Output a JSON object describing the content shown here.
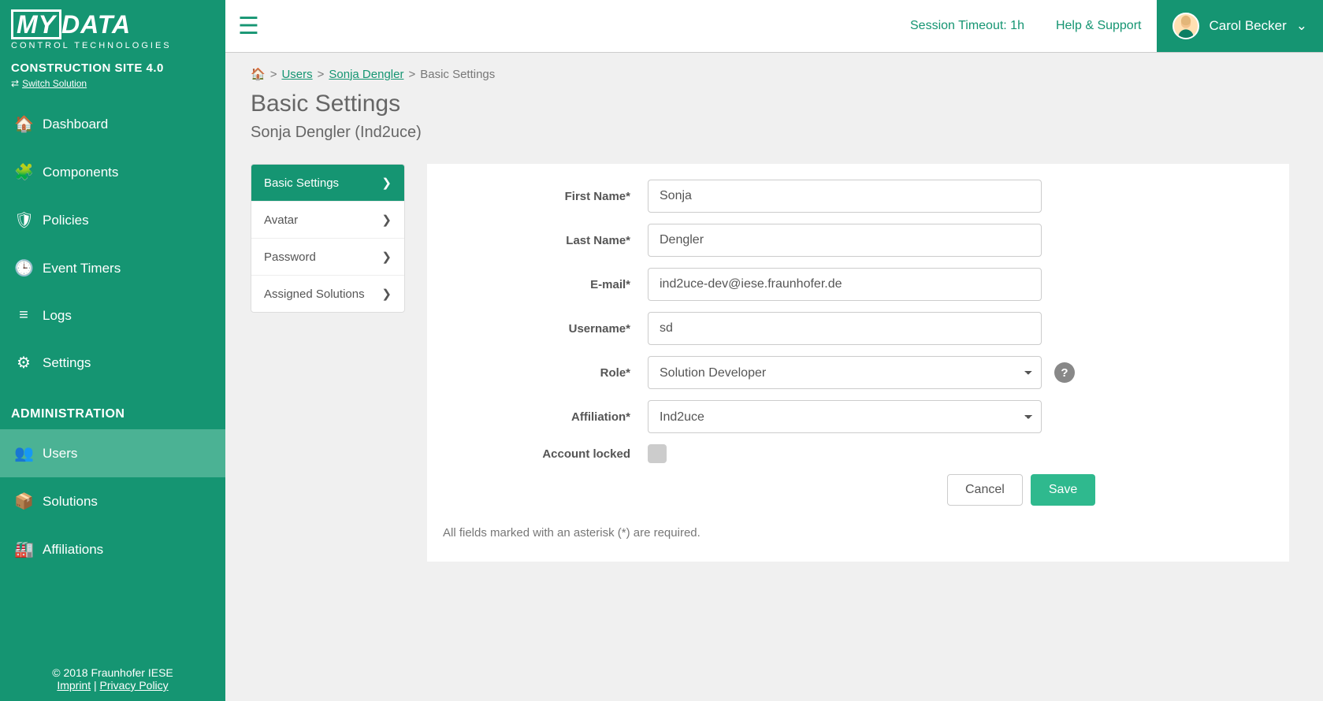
{
  "brand": {
    "logo_my": "MY",
    "logo_data": "DATA",
    "logo_sub": "CONTROL TECHNOLOGIES"
  },
  "solution": {
    "title": "CONSTRUCTION SITE 4.0",
    "switch_label": "Switch Solution"
  },
  "nav": {
    "items": [
      {
        "label": "Dashboard",
        "icon": "home"
      },
      {
        "label": "Components",
        "icon": "puzzle"
      },
      {
        "label": "Policies",
        "icon": "shield"
      },
      {
        "label": "Event Timers",
        "icon": "clock"
      },
      {
        "label": "Logs",
        "icon": "list"
      },
      {
        "label": "Settings",
        "icon": "gears"
      }
    ],
    "admin_header": "ADMINISTRATION",
    "admin_items": [
      {
        "label": "Users",
        "icon": "users",
        "active": true
      },
      {
        "label": "Solutions",
        "icon": "cubes"
      },
      {
        "label": "Affiliations",
        "icon": "building"
      }
    ]
  },
  "footer": {
    "copyright": "© 2018 Fraunhofer IESE",
    "imprint": "Imprint",
    "privacy": "Privacy Policy"
  },
  "topbar": {
    "session": "Session Timeout: 1h",
    "help": "Help & Support",
    "user_name": "Carol Becker"
  },
  "breadcrumb": {
    "users": "Users",
    "user_name": "Sonja Dengler",
    "current": "Basic Settings"
  },
  "page": {
    "title": "Basic Settings",
    "subtitle": "Sonja Dengler (Ind2uce)"
  },
  "subnav": [
    {
      "label": "Basic Settings",
      "active": true
    },
    {
      "label": "Avatar"
    },
    {
      "label": "Password"
    },
    {
      "label": "Assigned Solutions"
    }
  ],
  "form": {
    "labels": {
      "first_name": "First Name*",
      "last_name": "Last Name*",
      "email": "E-mail*",
      "username": "Username*",
      "role": "Role*",
      "affiliation": "Affiliation*",
      "locked": "Account locked"
    },
    "values": {
      "first_name": "Sonja",
      "last_name": "Dengler",
      "email": "ind2uce-dev@iese.fraunhofer.de",
      "username": "sd",
      "role": "Solution Developer",
      "affiliation": "Ind2uce",
      "locked": false
    },
    "buttons": {
      "cancel": "Cancel",
      "save": "Save"
    },
    "note": "All fields marked with an asterisk (*) are required."
  }
}
